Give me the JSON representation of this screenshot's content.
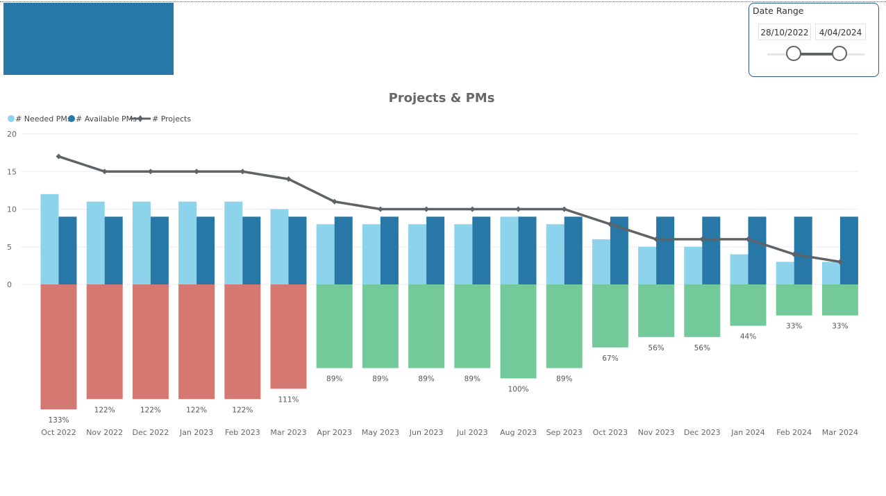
{
  "slicer": {
    "title": "Date Range",
    "start": "28/10/2022",
    "end": "4/04/2024"
  },
  "colors": {
    "needed": "#8DD3EC",
    "available": "#2878A7",
    "projects_line": "#5F6368",
    "over_capacity": "#D67872",
    "under_capacity": "#74C99A"
  },
  "chart_data": {
    "type": "bar",
    "title": "Projects & PMs",
    "categories": [
      "Oct 2022",
      "Nov 2022",
      "Dec 2022",
      "Jan 2023",
      "Feb 2023",
      "Mar 2023",
      "Apr 2023",
      "May 2023",
      "Jun 2023",
      "Jul 2023",
      "Aug 2023",
      "Sep 2023",
      "Oct 2023",
      "Nov 2023",
      "Dec 2023",
      "Jan 2024",
      "Feb 2024",
      "Mar 2024"
    ],
    "series": [
      {
        "name": "# Needed PMs",
        "type": "bar",
        "values": [
          12,
          11,
          11,
          11,
          11,
          10,
          8,
          8,
          8,
          8,
          9,
          8,
          6,
          5,
          5,
          4,
          3,
          3
        ]
      },
      {
        "name": "# Available PMs",
        "type": "bar",
        "values": [
          9,
          9,
          9,
          9,
          9,
          9,
          9,
          9,
          9,
          9,
          9,
          9,
          9,
          9,
          9,
          9,
          9,
          9
        ]
      },
      {
        "name": "# Projects",
        "type": "line",
        "values": [
          17,
          15,
          15,
          15,
          15,
          14,
          11,
          10,
          10,
          10,
          10,
          10,
          8,
          6,
          6,
          6,
          4,
          3
        ]
      }
    ],
    "ratio_labels": [
      "133%",
      "122%",
      "122%",
      "122%",
      "122%",
      "111%",
      "89%",
      "89%",
      "89%",
      "89%",
      "100%",
      "89%",
      "67%",
      "56%",
      "56%",
      "44%",
      "33%",
      "33%"
    ],
    "ratio_values": [
      133,
      122,
      122,
      122,
      122,
      111,
      89,
      89,
      89,
      89,
      100,
      89,
      67,
      56,
      56,
      44,
      33,
      33
    ],
    "y_ticks": [
      "0",
      "5",
      "10",
      "15",
      "20"
    ],
    "ylim": [
      0,
      20
    ],
    "legend_position": "top-left",
    "grid": true
  }
}
